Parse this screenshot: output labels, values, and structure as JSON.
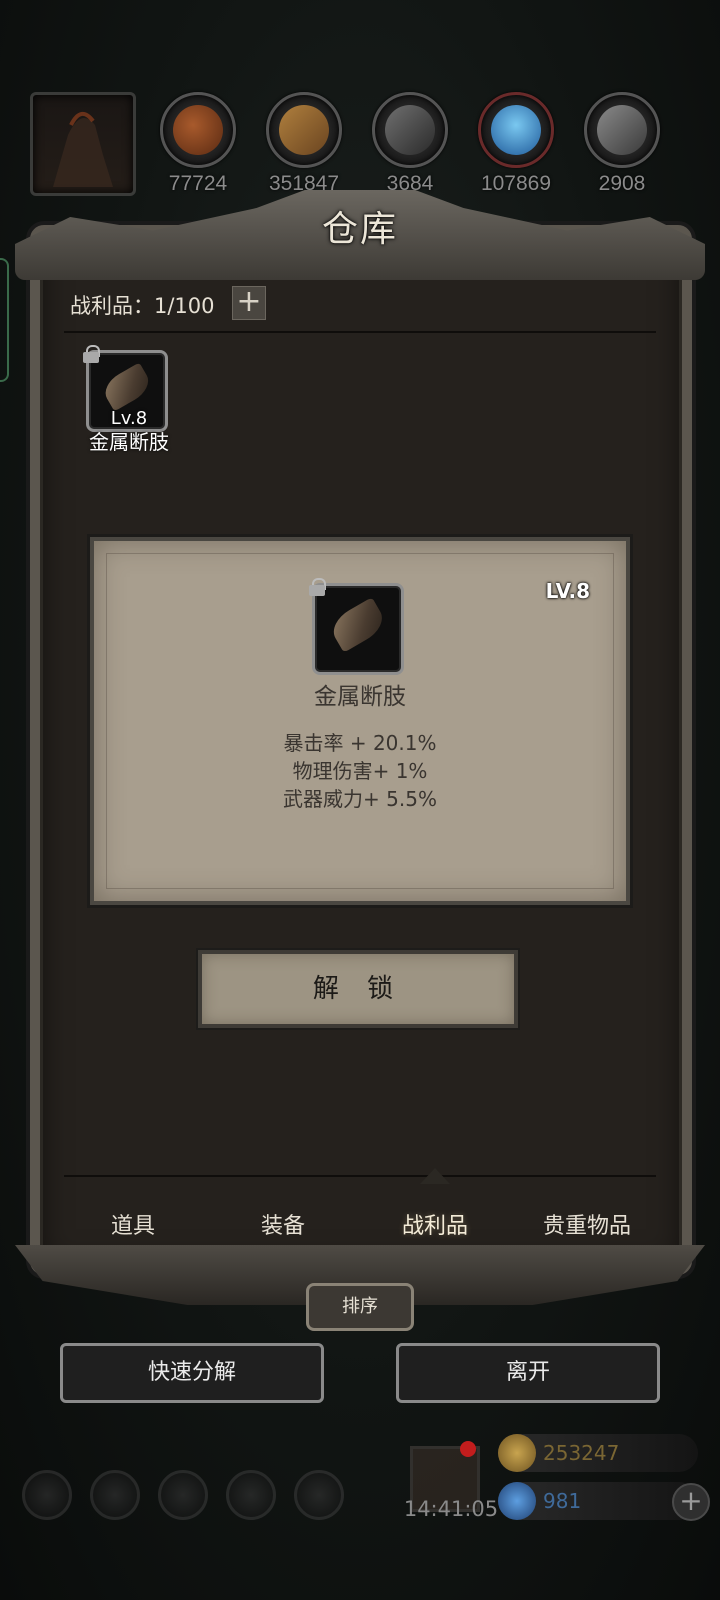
{
  "resources": [
    {
      "icon": "meat-icon",
      "value": "77724"
    },
    {
      "icon": "wood-icon",
      "value": "351847"
    },
    {
      "icon": "iron-icon",
      "value": "3684"
    },
    {
      "icon": "crystal-icon",
      "value": "107869"
    },
    {
      "icon": "ingot-icon",
      "value": "2908"
    }
  ],
  "panel": {
    "title": "仓库"
  },
  "inventory": {
    "label": "战利品：1/100"
  },
  "item": {
    "level": "Lv.8",
    "name": "金属断肢"
  },
  "detail": {
    "level": "LV.8",
    "name": "金属断肢",
    "stats": [
      "暴击率 + 20.1%",
      "物理伤害+ 1%",
      "武器威力+ 5.5%"
    ],
    "unlock_label": "解 锁"
  },
  "tabs": [
    "道具",
    "装备",
    "战利品",
    "贵重物品"
  ],
  "active_tab": "战利品",
  "sort_label": "排序",
  "buttons": {
    "quick_decompose": "快速分解",
    "leave": "离开"
  },
  "bottom": {
    "time": "14:41:05",
    "gold": "253247",
    "gems": "981"
  },
  "colors": {
    "gold": "#b8954a",
    "gem": "#3d7fd0",
    "frame": "#5b564e",
    "card": "#a89e8e"
  }
}
